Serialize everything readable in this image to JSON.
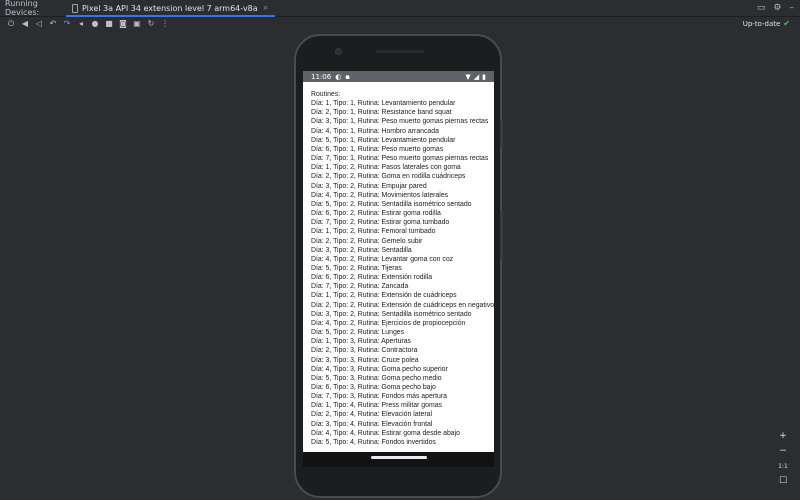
{
  "panel": {
    "title": "Running Devices:",
    "tab_label": "Pixel 3a API 34 extension level 7 arm64-v8a",
    "tab_close": "×",
    "status_text": "Up-to-date",
    "status_icon": "✔"
  },
  "toolbar": {
    "icons": [
      "power-icon",
      "volume-up-icon",
      "volume-down-icon",
      "rotate-left-icon",
      "rotate-right-icon",
      "back-icon",
      "home-icon",
      "overview-icon",
      "screenshot-icon",
      "screen-record-icon",
      "snapshot-icon",
      "more-icon"
    ]
  },
  "phone": {
    "time": "11:06",
    "header": "Routines:",
    "lines": [
      "Día: 1, Tipo: 1, Rutina: Levantamiento pendular",
      "Día: 2, Tipo: 1, Rutina: Resistance band squat",
      "Día: 3, Tipo: 1, Rutina: Peso muerto gomas piernas rectas",
      "Día: 4, Tipo: 1, Rutina: Hombro arrancada",
      "Día: 5, Tipo: 1, Rutina: Levantamiento pendular",
      "Día: 6, Tipo: 1, Rutina: Peso muerto gomas",
      "Día: 7, Tipo: 1, Rutina: Peso muerto gomas piernas rectas",
      "Día: 1, Tipo: 2, Rutina: Pasos laterales con goma",
      "Día: 2, Tipo: 2, Rutina: Goma en rodilla cuádriceps",
      "Día: 3, Tipo: 2, Rutina: Empujar pared",
      "Día: 4, Tipo: 2, Rutina: Movimientos laterales",
      "Día: 5, Tipo: 2, Rutina: Sentadilla isométrico sentado",
      "Día: 6, Tipo: 2, Rutina: Estirar goma rodilla",
      "Día: 7, Tipo: 2, Rutina: Estirar goma tumbado",
      "Día: 1, Tipo: 2, Rutina: Femoral tumbado",
      "Día: 2, Tipo: 2, Rutina: Gemelo subir",
      "Día: 3, Tipo: 2, Rutina: Sentadilla",
      "Día: 4, Tipo: 2, Rutina: Levantar goma con coz",
      "Día: 5, Tipo: 2, Rutina: Tijeras",
      "Día: 6, Tipo: 2, Rutina: Extensión rodilla",
      "Día: 7, Tipo: 2, Rutina: Zancada",
      "Día: 1, Tipo: 2, Rutina: Extensión de cuádriceps",
      "Día: 2, Tipo: 2, Rutina: Extensión de cuádriceps en negativo",
      "Día: 3, Tipo: 2, Rutina: Sentadilla isométrico sentado",
      "Día: 4, Tipo: 2, Rutina: Ejercicios de propiocepción",
      "Día: 5, Tipo: 2, Rutina: Lunges",
      "Día: 1, Tipo: 3, Rutina: Aperturas",
      "Día: 2, Tipo: 3, Rutina: Contractora",
      "Día: 3, Tipo: 3, Rutina: Cruce polea",
      "Día: 4, Tipo: 3, Rutina: Goma pecho superior",
      "Día: 5, Tipo: 3, Rutina: Goma pecho medio",
      "Día: 6, Tipo: 3, Rutina: Goma pecho bajo",
      "Día: 7, Tipo: 3, Rutina: Fondos más apertura",
      "Día: 1, Tipo: 4, Rutina: Press militar gomas",
      "Día: 2, Tipo: 4, Rutina: Elevación lateral",
      "Día: 3, Tipo: 4, Rutina: Elevación frontal",
      "Día: 4, Tipo: 4, Rutina: Estirar goma desde abajo",
      "Día: 5, Tipo: 4, Rutina: Fondos invertidos"
    ]
  },
  "zoom": {
    "zoom_in": "+",
    "zoom_out": "−",
    "ratio": "1:1",
    "fit": "☐"
  },
  "colors": {
    "accent": "#3574f0",
    "status_ok": "#5fb865",
    "background": "#2b2d30"
  }
}
